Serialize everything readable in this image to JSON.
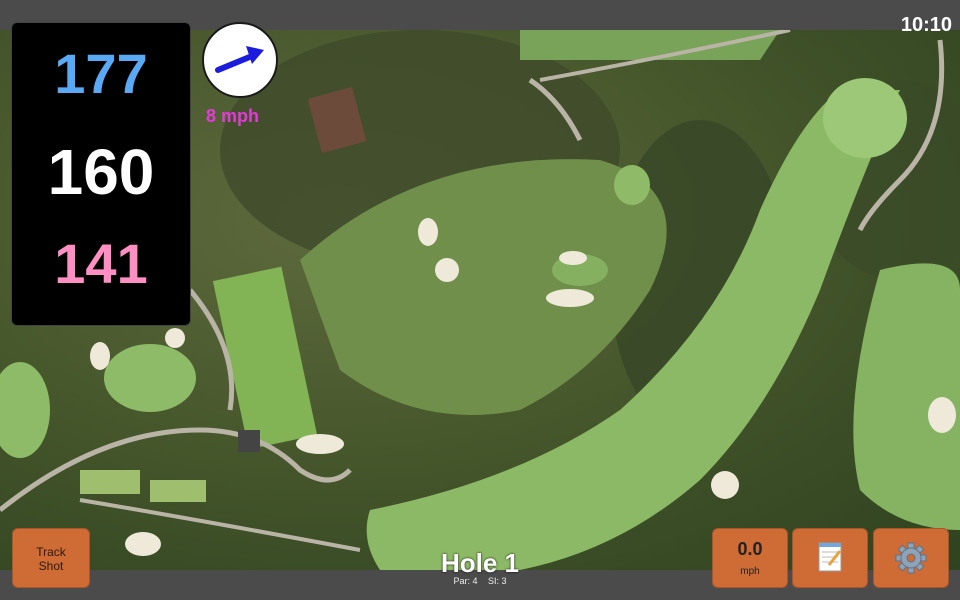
{
  "status": {
    "time": "10:10"
  },
  "distances": {
    "back": "177",
    "middle": "160",
    "front": "141"
  },
  "wind": {
    "speed": "8 mph",
    "arrow_icon": "wind-direction-arrow-icon"
  },
  "controls": {
    "track_shot_line1": "Track",
    "track_shot_line2": "Shot",
    "wind_value": "0.0",
    "wind_unit": "mph",
    "notes_icon": "notepad-icon",
    "settings_icon": "gear-icon"
  },
  "hole": {
    "title": "Hole 1",
    "par": "Par: 4",
    "si": "SI: 3"
  },
  "colors": {
    "button": "#cf6b35",
    "back_yardage": "#5aa9f5",
    "front_yardage": "#ff8ec2",
    "wind_text": "#e33ad9"
  }
}
